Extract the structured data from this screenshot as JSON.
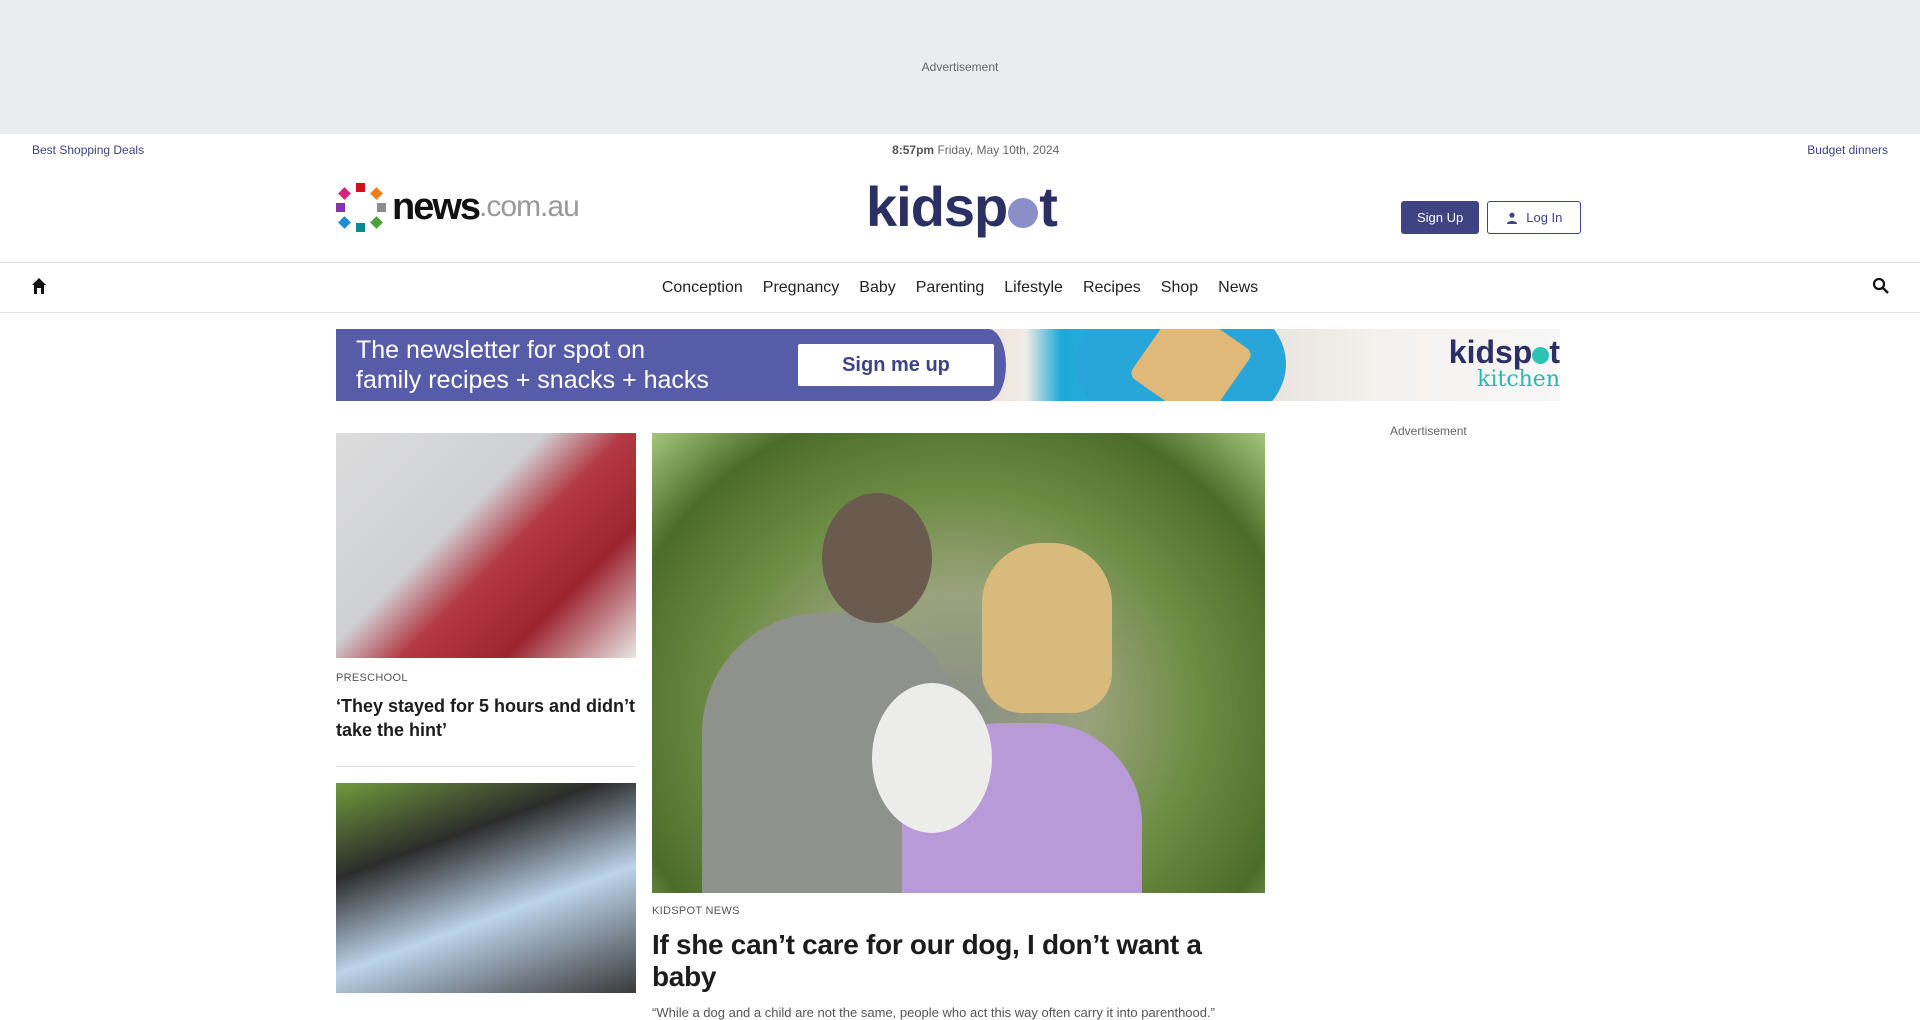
{
  "top_ad": {
    "label": "Advertisement"
  },
  "utility_bar": {
    "left_link": "Best Shopping Deals",
    "time": "8:57pm",
    "date": "Friday, May 10th, 2024",
    "right_link": "Budget dinners"
  },
  "masthead": {
    "news_logo_word": "news",
    "news_logo_domain": ".com.au",
    "kidspot_logo_pre": "kidsp",
    "kidspot_logo_post": "t",
    "signup_label": "Sign Up",
    "login_label": "Log In"
  },
  "nav": {
    "items": [
      "Conception",
      "Pregnancy",
      "Baby",
      "Parenting",
      "Lifestyle",
      "Recipes",
      "Shop",
      "News"
    ]
  },
  "banner": {
    "text_line1": "The newsletter for spot on",
    "text_line2": "family recipes + snacks + hacks",
    "button_label": "Sign me up",
    "brand_pre": "kidsp",
    "brand_post": "t",
    "brand_sub": "kitchen"
  },
  "side_ad": {
    "label": "Advertisement"
  },
  "articles": [
    {
      "kicker": "PRESCHOOL",
      "headline": "‘They stayed for 5 hours and didn’t take the hint’"
    }
  ],
  "featured": {
    "kicker": "KIDSPOT NEWS",
    "headline": "If she can’t care for our dog, I don’t want a baby",
    "standfirst": "“While a dog and a child are not the same, people who act this way often carry it into parenthood.”"
  },
  "colors": {
    "brand_navy": "#3e4384",
    "banner_purple": "#575ca8",
    "kidspot_dot": "#8b8fc9",
    "kitchen_teal": "#2bb8ac"
  }
}
